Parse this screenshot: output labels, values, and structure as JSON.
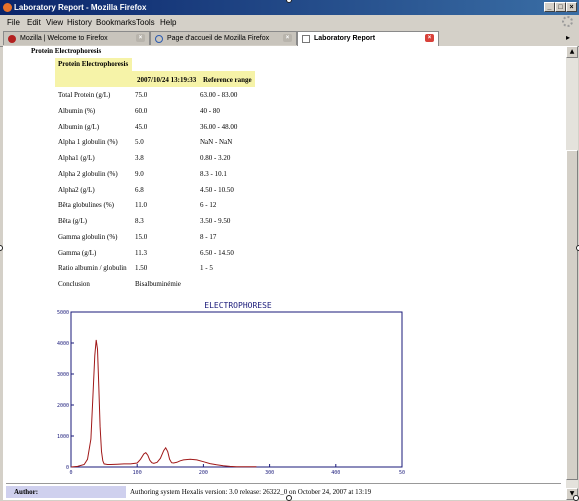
{
  "window": {
    "title": "Laboratory Report - Mozilla Firefox"
  },
  "menu": [
    "File",
    "Edit",
    "View",
    "History",
    "Bookmarks",
    "Tools",
    "Help"
  ],
  "tabs": [
    {
      "label": "Mozilla | Welcome to Firefox",
      "active": false
    },
    {
      "label": "Page d'accueil de Mozilla Firefox",
      "active": false
    },
    {
      "label": "Laboratory Report",
      "active": true
    }
  ],
  "report": {
    "section_title": "Protein Electrophoresis",
    "table_title": "Protein Electrophoresis",
    "date_header": "2007/10/24 13:19:33",
    "ref_header": "Reference range",
    "rows": [
      {
        "name": "Total Protein (g/L)",
        "value": "75.0",
        "ref": "63.00 - 83.00"
      },
      {
        "name": "Albumin (%)",
        "value": "60.0",
        "ref": "40 - 80"
      },
      {
        "name": "Albumin (g/L)",
        "value": "45.0",
        "ref": "36.00 - 48.00"
      },
      {
        "name": "Alpha 1 globulin (%)",
        "value": "5.0",
        "ref": "NaN - NaN"
      },
      {
        "name": "Alpha1 (g/L)",
        "value": "3.8",
        "ref": "0.80 - 3.20"
      },
      {
        "name": "Alpha 2 globulin (%)",
        "value": "9.0",
        "ref": "8.3 - 10.1"
      },
      {
        "name": "Alpha2 (g/L)",
        "value": "6.8",
        "ref": "4.50 - 10.50"
      },
      {
        "name": "Bêta globulines (%)",
        "value": "11.0",
        "ref": "6 - 12"
      },
      {
        "name": "Bêta (g/L)",
        "value": "8.3",
        "ref": "3.50 - 9.50"
      },
      {
        "name": "Gamma globulin (%)",
        "value": "15.0",
        "ref": "8 - 17"
      },
      {
        "name": "Gamma (g/L)",
        "value": "11.3",
        "ref": "6.50 - 14.50"
      },
      {
        "name": "Ratio albumin / globulin",
        "value": "1.50",
        "ref": "1 - 5"
      },
      {
        "name": "Conclusion",
        "value": "Bisalbuminémie",
        "ref": ""
      }
    ]
  },
  "chart_data": {
    "type": "line",
    "title": "ELECTROPHORESE",
    "xlim": [
      0,
      500
    ],
    "ylim": [
      0,
      5000
    ],
    "x_ticks": [
      "0",
      "100",
      "200",
      "300",
      "400",
      "50"
    ],
    "y_ticks": [
      "0",
      "1000",
      "2000",
      "3000",
      "4000",
      "5000"
    ],
    "grid": false,
    "series": [
      {
        "color": "#a01818",
        "x": [
          0,
          10,
          20,
          25,
          30,
          33,
          36,
          38,
          40,
          42,
          44,
          46,
          48,
          50,
          55,
          60,
          70,
          80,
          90,
          100,
          105,
          110,
          113,
          116,
          119,
          122,
          125,
          130,
          135,
          140,
          143,
          146,
          149,
          152,
          155,
          160,
          165,
          170,
          180,
          190,
          200,
          210,
          220,
          230,
          240,
          250,
          260,
          270,
          280
        ],
        "y": [
          0,
          20,
          80,
          250,
          900,
          2200,
          3600,
          4100,
          3800,
          2600,
          1300,
          500,
          200,
          100,
          80,
          80,
          90,
          100,
          100,
          130,
          250,
          420,
          460,
          380,
          220,
          140,
          120,
          150,
          280,
          530,
          620,
          500,
          250,
          140,
          130,
          150,
          200,
          230,
          250,
          230,
          170,
          110,
          70,
          40,
          20,
          10,
          5,
          5,
          5
        ]
      }
    ]
  },
  "footer": {
    "author_label": "Author:",
    "author_value": "Authoring system Hexalis version: 3.0 release: 26322_0 on October 24, 2007 at 13:19"
  },
  "colors": {
    "title_bar": "#0a246a",
    "table_header": "#f6f3a8",
    "author_label_bg": "#cfd0ee",
    "chart_line": "#a01818",
    "chart_axis": "#1a1a7a"
  }
}
